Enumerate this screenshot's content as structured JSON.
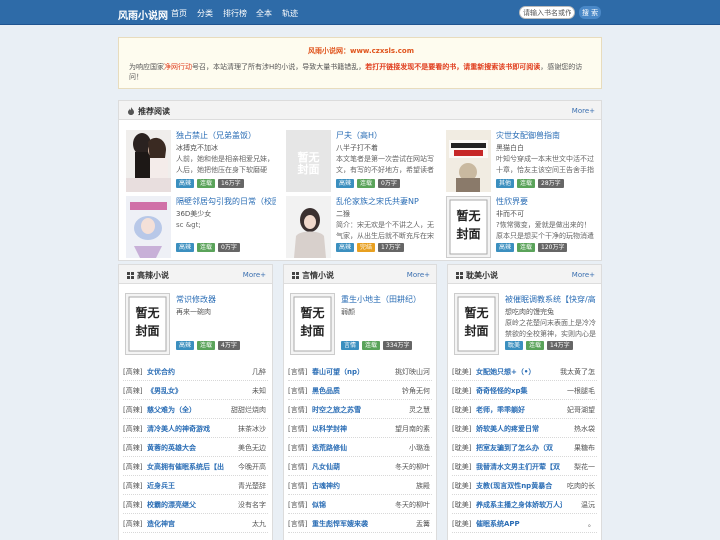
{
  "nav": {
    "logo": "风雨小说网",
    "items": [
      "首页",
      "分类",
      "排行榜",
      "全本",
      "轨迹"
    ],
    "search_placeholder": "请输入书名或作者",
    "search_button": "搜 索"
  },
  "notice": {
    "title": "风雨小说网：www.czxsls.com",
    "part1": "为响应国家",
    "part2": "净网行动",
    "part3": "号召，本站清理了所有涉H的小说，导致大量书籍错乱，",
    "part4": "若打开链接发现不是要看的书，请重新搜索该书即可阅读",
    "part5": "，感谢您的访问！"
  },
  "recommend": {
    "title": "推荐阅读",
    "more": "More+",
    "books": [
      {
        "title": "独占禁止（兄弟盖饭）",
        "author": "冰搏克不加冰",
        "desc": "人前，她和他是相亲相爱兄妹，人后，她把他压在身下软磨硬泡：",
        "tags": [
          "高辣",
          "连载",
          "16万字"
        ],
        "cover": "photo"
      },
      {
        "title": "尸夫（高H）",
        "author": "八半子打不着",
        "desc": "本文笔者是第一次尝试在网站写文，有写的不好地方，希望读者大",
        "tags": [
          "高辣",
          "连载",
          "0万字"
        ],
        "cover": "default"
      },
      {
        "title": "灾世女配御兽指南",
        "author": "黑猫白白",
        "desc": "叶知兮穿成一本末世文中活不过十章，恰友主该空间王告舍手指的恶",
        "tags": [
          "其他",
          "连载",
          "28万字"
        ],
        "cover": "book3"
      },
      {
        "title": "隔壁邻居勾引我的日常（校园",
        "author": "36D美少女",
        "desc": "sc &gt;",
        "tags": [
          "高辣",
          "连载",
          "0万字"
        ],
        "cover": "book4"
      },
      {
        "title": "乱伦家族之宋氏共妻NP",
        "author": "二猴",
        "desc": "简介：宋无欢是个不讲之人，无气家，从出生后就不断充斥在宋家女",
        "tags": [
          "高辣",
          "完结",
          "17万字"
        ],
        "cover": "book5"
      },
      {
        "title": "性欣界要",
        "author": "非而不可",
        "desc": "?恢常微变，爱就是做出来的！原本只是想买个干净的玩物消遣一",
        "tags": [
          "高辣",
          "连载",
          "120万字"
        ],
        "cover": "default"
      }
    ]
  },
  "columns": [
    {
      "title": "高辣小说",
      "more": "More+",
      "featured": {
        "title": "常识修改器",
        "author": "再来一碗肉",
        "desc": "",
        "tags": [
          "高辣",
          "连载",
          "4万字"
        ]
      },
      "list": [
        [
          "[高辣]",
          "女优合约",
          "几醉"
        ],
        [
          "[高辣]",
          "《男乱女》",
          "未知"
        ],
        [
          "[高辣]",
          "慈父难为（全）",
          "甜甜烂烧肉"
        ],
        [
          "[高辣]",
          "清冷美人的神奇游戏",
          "抹茶冰沙"
        ],
        [
          "[高辣]",
          "黄蓉的英雄大会",
          "美色无边"
        ],
        [
          "[高辣]",
          "女高拥有催眠系统后【出",
          "今晚开高"
        ],
        [
          "[高辣]",
          "近身兵王",
          "青光楚辞"
        ],
        [
          "[高辣]",
          "校霸的漂亮继父",
          "没有名字"
        ],
        [
          "[高辣]",
          "造化神宫",
          "太九"
        ]
      ]
    },
    {
      "title": "言情小说",
      "more": "More+",
      "featured": {
        "title": "重生小地主（田耕纪）",
        "author": "弱颜",
        "desc": "",
        "tags": [
          "言情",
          "连载",
          "334万字"
        ]
      },
      "list": [
        [
          "[言情]",
          "春山可望（np）",
          "挑灯映山河"
        ],
        [
          "[言情]",
          "黑色品质",
          "钤角无何"
        ],
        [
          "[言情]",
          "时空之旅之苏雪",
          "灵之慧"
        ],
        [
          "[言情]",
          "以科学封神",
          "望月南的素"
        ],
        [
          "[言情]",
          "逃荒路修仙",
          "小璐渔"
        ],
        [
          "[言情]",
          "凡女仙葫",
          "冬天的柳叶"
        ],
        [
          "[言情]",
          "古魂神约",
          "族殿"
        ],
        [
          "[言情]",
          "似锦",
          "冬天的柳叶"
        ],
        [
          "[言情]",
          "重生彪悍军嫂来袭",
          "盂篝"
        ]
      ]
    },
    {
      "title": "耽美小说",
      "more": "More+",
      "featured": {
        "title": "被催眠调教系统【快穿/高",
        "author": "想吃肉的馒完兔",
        "desc": "原岭之花楚问末表面上是冷冷禁欲的全校第神，实则内心是",
        "tags": [
          "耽美",
          "连载",
          "14万字"
        ]
      },
      "list": [
        [
          "[耽美]",
          "女配她只想+（•）",
          "我太黄了怎"
        ],
        [
          "[耽美]",
          "奇奇怪怪的xp集",
          "一根腿毛"
        ],
        [
          "[耽美]",
          "老师，乖乖躺好",
          "妃哥湖望"
        ],
        [
          "[耽美]",
          "娇软美人的疼爱日常",
          "热水袋"
        ],
        [
          "[耽美]",
          "把室友骗到了怎么办（双",
          "果糖布"
        ],
        [
          "[耽美]",
          "我替清水文男主们开荤【双",
          "梨花一"
        ],
        [
          "[耽美]",
          "支教(现言双性np黄暴合",
          "吃肉的长"
        ],
        [
          "[耽美]",
          "养成系主播之身体娇软万人迷",
          "温沅"
        ],
        [
          "[耽美]",
          "催眠系统APP",
          "。"
        ]
      ]
    }
  ]
}
